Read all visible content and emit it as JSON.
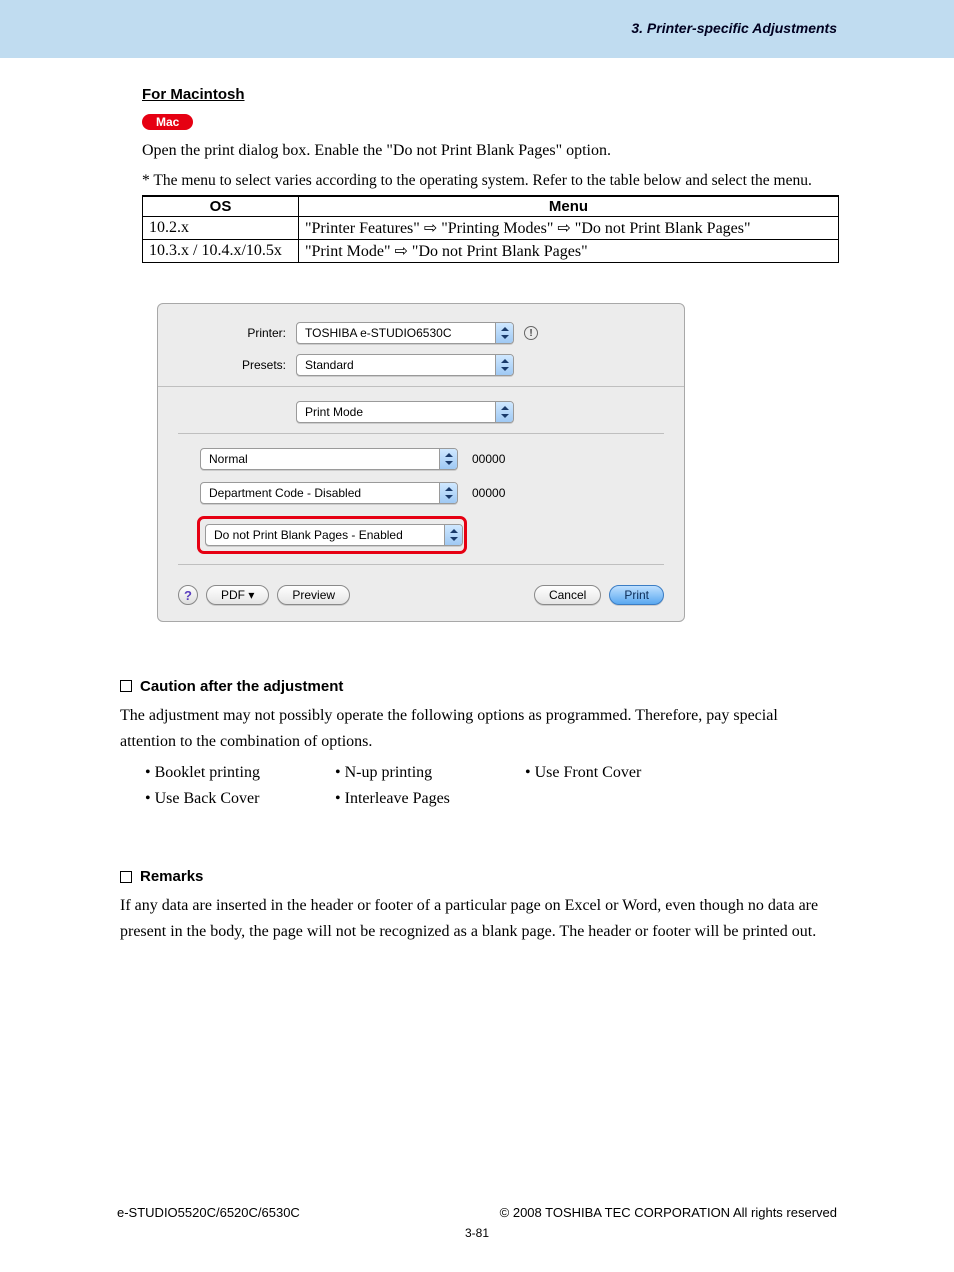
{
  "header": {
    "chapter": "3. Printer-specific Adjustments"
  },
  "mac": {
    "heading": "For Macintosh",
    "badge": "Mac",
    "intro": "Open the print dialog box.  Enable the \"Do not Print Blank Pages\" option.",
    "note": "* The menu to select varies according to the operating system.  Refer to the table below and select the menu.",
    "table": {
      "headers": {
        "os": "OS",
        "menu": "Menu"
      },
      "rows": [
        {
          "os": "10.2.x",
          "menu": "\"Printer Features\" ⇨ \"Printing Modes\" ⇨ \"Do not Print Blank Pages\""
        },
        {
          "os": "10.3.x / 10.4.x/10.5x",
          "menu": "\"Print Mode\" ⇨ \"Do not Print Blank Pages\""
        }
      ]
    }
  },
  "dialog": {
    "printer_label": "Printer:",
    "printer_value": "TOSHIBA e-STUDIO6530C",
    "presets_label": "Presets:",
    "presets_value": "Standard",
    "mode_value": "Print Mode",
    "quality": "Normal",
    "quality_code": "00000",
    "dept": "Department Code - Disabled",
    "dept_code": "00000",
    "blank": "Do not Print Blank Pages - Enabled",
    "pdf_btn": "PDF ▾",
    "preview_btn": "Preview",
    "cancel_btn": "Cancel",
    "print_btn": "Print"
  },
  "caution": {
    "title": "Caution after the adjustment",
    "text": "The adjustment may not possibly operate the following options as programmed.  Therefore, pay special attention to the combination of options.",
    "items": [
      "Booklet printing",
      "N-up printing",
      "Use Front Cover",
      "Use Back Cover",
      "Interleave Pages"
    ]
  },
  "remarks": {
    "title": "Remarks",
    "text": "If any data are inserted in the header or footer of a particular page on Excel or Word, even though no data are present in the body, the page will not be recognized as a blank page.  The header or footer will be printed out."
  },
  "footer": {
    "left": "e-STUDIO5520C/6520C/6530C",
    "right": "© 2008 TOSHIBA TEC CORPORATION All rights reserved",
    "page": "3-81"
  }
}
